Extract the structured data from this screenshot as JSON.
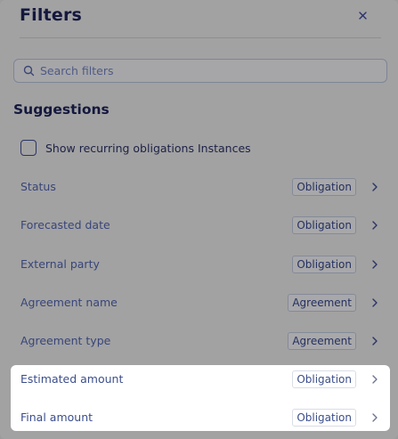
{
  "header": {
    "title": "Filters",
    "close_icon": "close-icon"
  },
  "search": {
    "placeholder": "Search filters",
    "icon": "search-icon"
  },
  "suggestions": {
    "title": "Suggestions",
    "recurring_checkbox_label": "Show recurring obligations Instances",
    "recurring_checked": false,
    "items": [
      {
        "label": "Status",
        "badge": "Obligation",
        "highlighted": false
      },
      {
        "label": "Forecasted date",
        "badge": "Obligation",
        "highlighted": false
      },
      {
        "label": "External party",
        "badge": "Obligation",
        "highlighted": false
      },
      {
        "label": "Agreement name",
        "badge": "Agreement",
        "highlighted": false
      },
      {
        "label": "Agreement type",
        "badge": "Agreement",
        "highlighted": false
      },
      {
        "label": "Estimated amount",
        "badge": "Obligation",
        "highlighted": true
      },
      {
        "label": "Final amount",
        "badge": "Obligation",
        "highlighted": true
      }
    ]
  },
  "colors": {
    "overlay": "#a2a2a2",
    "title_text": "#14183d",
    "label_text": "#38457a",
    "highlight_bg": "#ffffff"
  }
}
